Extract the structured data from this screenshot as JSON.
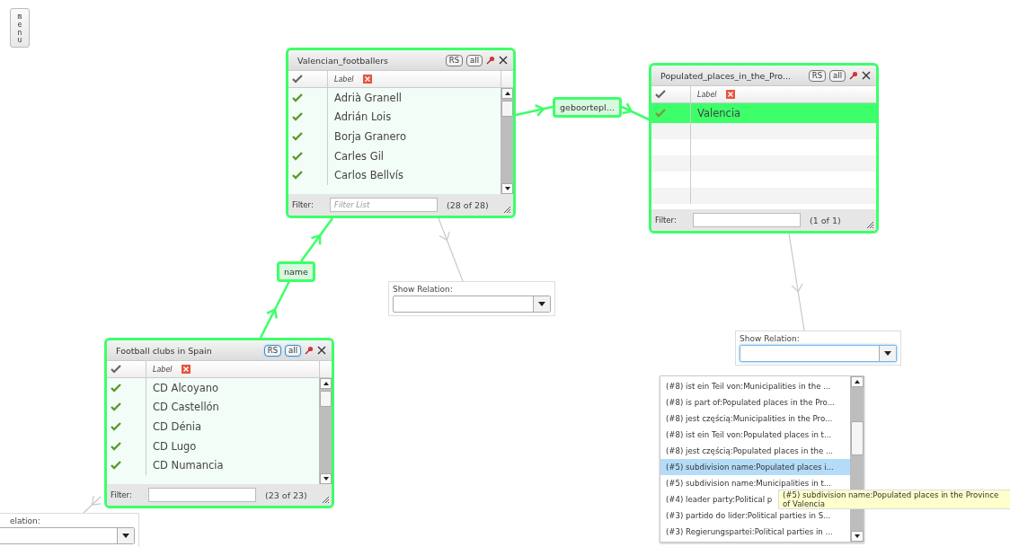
{
  "menu_button": {
    "label": "menu"
  },
  "panels": [
    {
      "title": "Valencian_footballers",
      "buttons": [
        {
          "label": "RS"
        },
        {
          "label": "all"
        }
      ],
      "buttons_highlighted": false,
      "column_label": "Label",
      "scrollbar": true,
      "rows": [
        {
          "label": "Adrià Granell",
          "checked": true,
          "selected": false
        },
        {
          "label": "Adrián Lois",
          "checked": true,
          "selected": false
        },
        {
          "label": "Borja Granero",
          "checked": true,
          "selected": false
        },
        {
          "label": "Carles Gil",
          "checked": true,
          "selected": false
        },
        {
          "label": "Carlos Bellvís",
          "checked": true,
          "selected": false
        }
      ],
      "filter_label": "Filter:",
      "filter_placeholder": "Filter List",
      "count": "(28 of 28)"
    },
    {
      "title": "Populated_places_in_the_Pro...",
      "buttons": [
        {
          "label": "RS"
        },
        {
          "label": "all"
        }
      ],
      "buttons_highlighted": false,
      "column_label": "Label",
      "scrollbar": false,
      "rows": [
        {
          "label": "Valencia",
          "checked": true,
          "selected": true
        }
      ],
      "filter_label": "Filter:",
      "count": "(1 of 1)"
    },
    {
      "title": "Football clubs in Spain",
      "buttons": [
        {
          "label": "RS"
        },
        {
          "label": "all"
        }
      ],
      "buttons_highlighted": true,
      "column_label": "Label",
      "scrollbar": true,
      "rows": [
        {
          "label": "CD Alcoyano",
          "checked": true,
          "selected": false
        },
        {
          "label": "CD Castellón",
          "checked": true,
          "selected": false
        },
        {
          "label": "CD Dénia",
          "checked": true,
          "selected": false
        },
        {
          "label": "CD Lugo",
          "checked": true,
          "selected": false
        },
        {
          "label": "CD Numancia",
          "checked": true,
          "selected": false
        }
      ],
      "filter_label": "Filter:",
      "count": "(23 of 23)"
    }
  ],
  "edge_labels": [
    {
      "label": "geboortepl..."
    },
    {
      "label": "name"
    }
  ],
  "relation_selectors": [
    {
      "label": "Show Relation:",
      "focused": false
    },
    {
      "label": "Show Relation:",
      "focused": true
    },
    {
      "label": "elation:",
      "focused": false
    }
  ],
  "relation_list": {
    "items": [
      {
        "label": "(#8) ist ein Teil von:Municipalities in the ...",
        "selected": false
      },
      {
        "label": "(#8) is part of:Populated places in the Pro...",
        "selected": false
      },
      {
        "label": "(#8) jest częścią:Municipalities in the Pro...",
        "selected": false
      },
      {
        "label": "(#8) ist ein Teil von:Populated places in t...",
        "selected": false
      },
      {
        "label": "(#8) jest częścią:Populated places in the ...",
        "selected": false
      },
      {
        "label": "(#5) subdivision name:Populated places i...",
        "selected": true
      },
      {
        "label": "(#5) subdivision name:Municipalities in t...",
        "selected": false
      },
      {
        "label": "(#4) leader party:Political p",
        "selected": false
      },
      {
        "label": "(#3) partido do lider:Political parties in S...",
        "selected": false
      },
      {
        "label": "(#3) Regierungspartei:Political parties in ...",
        "selected": false
      }
    ]
  },
  "tooltip": {
    "text": "(#5) subdivision name:Populated places in the Province of Valencia"
  }
}
